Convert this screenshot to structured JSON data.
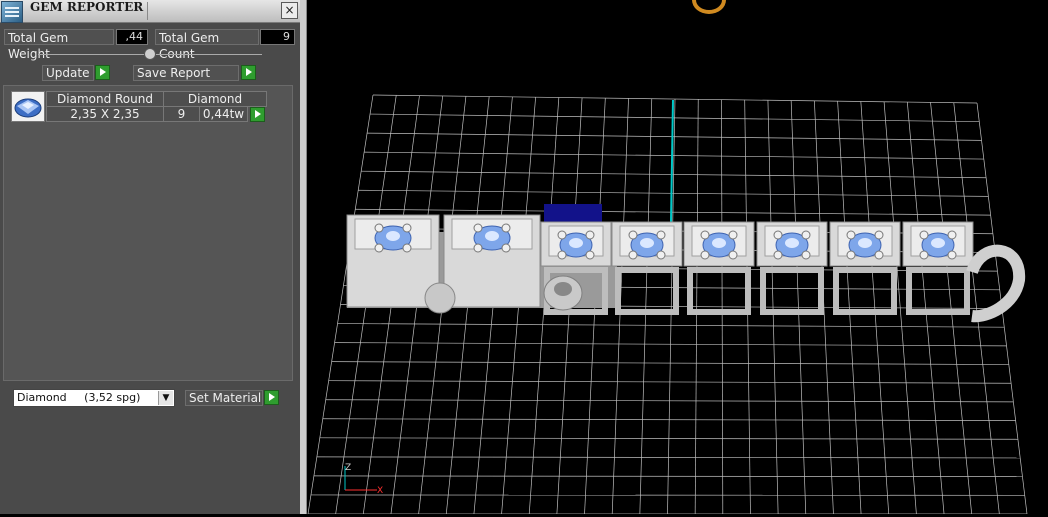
{
  "window": {
    "title": "GEM REPORTER",
    "close_label": "×"
  },
  "totals": {
    "weight_label": "Total Gem Weight",
    "weight_value": ",44",
    "count_label": "Total Gem Count",
    "count_value": "9"
  },
  "actions": {
    "update_label": "Update",
    "save_label": "Save Report"
  },
  "gem_row": {
    "header_name": "Diamond Round",
    "header_material": "Diamond",
    "size": "2,35 X 2,35",
    "count": "9",
    "weight": "0,44tw",
    "thumb_icon": "round-diamond-icon"
  },
  "material": {
    "selected": "Diamond     (3,52 spg)",
    "set_label": "Set Material"
  },
  "colors": {
    "panel": "#4a4a4a",
    "accent_green": "#2f9d2f",
    "grid": "#ffffff",
    "gem_blue": "#7ea6ea",
    "axis_cyan": "#00c8c8"
  }
}
